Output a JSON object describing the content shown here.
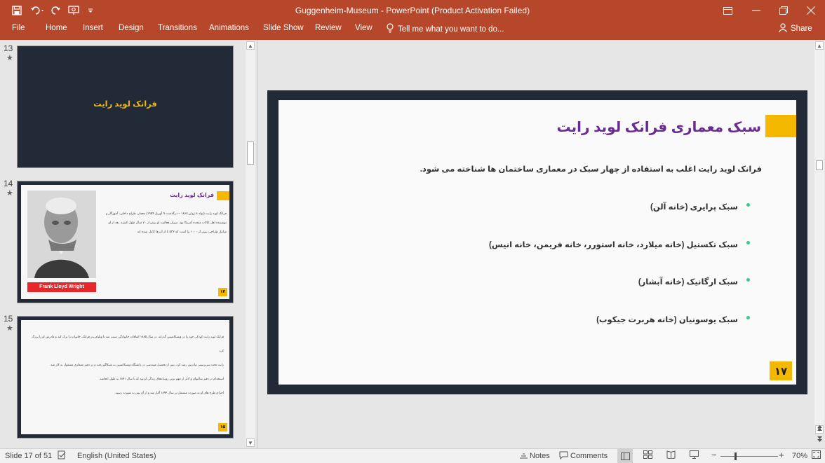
{
  "window": {
    "title": "Guggenheim-Museum - PowerPoint (Product Activation Failed)",
    "controls": [
      "▭",
      "─",
      "❐",
      "✕"
    ]
  },
  "quick_access": {
    "save_icon": "save-icon",
    "undo_icon": "undo-icon",
    "redo_icon": "redo-icon",
    "present_icon": "present-from-beginning-icon",
    "customize_icon": "customize-icon"
  },
  "ribbon": {
    "tabs": [
      "File",
      "Home",
      "Insert",
      "Design",
      "Transitions",
      "Animations",
      "Slide Show",
      "Review",
      "View"
    ],
    "tell_me": "Tell me what you want to do...",
    "share": "Share"
  },
  "thumbnails": [
    {
      "number": "13",
      "star": "★",
      "title": "فرانک لوید رایت"
    },
    {
      "number": "14",
      "star": "★",
      "title": "فرانک لوید رایت",
      "caption": "Frank Lloyd Wright",
      "page": "۱۴",
      "lines": [
        "فرانک لوید رایت (تولد ۸ ژوئن ۱۸۶۷ – درگذشت ۹ آوریل ۱۹۵۹) معمار، طراح داخلی، آموزگار و",
        "نویسنده اهل ایالات متحده آمریکا بود. میزان فعالیت او بیش از ۷۰ سال طول کشید. بعد از او",
        "شامل طراحی بیش از ۱۰۰۰ بنا است که ۵۳۲ تا از آن ها کامل شده اند."
      ]
    },
    {
      "number": "15",
      "star": "★",
      "page": "۱۵",
      "lines": [
        "فرانک لوید رایت کودکی خود را در ویسکانسین گذراند. در سال ۱۸۸۵ اتفاقات خانوادگی سبب شد تا ویلیام پدر فرانک، خانواده را ترک کند و مادرش او را بزرگ کرد.",
        "رایت تحت سرپرستی مادرش رشد کرد. پس از تحصیل مهندسی در دانشگاه ویسکانسین به شیکاگو رفت و در دفتر معماری مشغول به کار شد.",
        "استخدام در دفتر سالیوان و آدلر از مهم ترین رویدادهای زندگی او بود که تا سال ۱۸۹۱ به طول انجامید.",
        "اجرای طرح های او به صورت مستقل در سال ۱۸۹۳ آغاز شد و از آن پس به شهرت رسید."
      ]
    }
  ],
  "slide": {
    "title": "سبک معماری فرانک لوید رایت",
    "intro": "فرانک لوید رایت اغلب به استفاده از چهار سبک در معماری ساختمان ها شناخته می شود.",
    "bullets": [
      "سبک پرایری (خانه آلن)",
      "سبک تکستیل (خانه میلارد، خانه استورر، خانه فریمن، خانه انیس)",
      "سبک ارگانیک (خانه آبشار)",
      "سبک یوسونیان (خانه هربرت جیکوب)"
    ],
    "page_number": "۱۷",
    "colors": {
      "title": "#6a2c91",
      "accent": "#f4b800",
      "bullet": "#3dc68a",
      "frame": "#232a37"
    }
  },
  "status": {
    "slide_info": "Slide 17 of 51",
    "language": "English (United States)",
    "notes": "Notes",
    "comments": "Comments",
    "zoom_minus": "−",
    "zoom_plus": "+",
    "zoom": "70%"
  }
}
